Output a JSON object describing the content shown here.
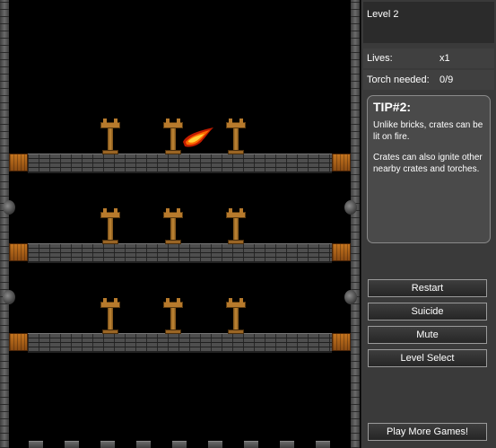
{
  "hud": {
    "level": "Level 2",
    "lives_label": "Lives:",
    "lives_value": "x1",
    "torch_label": "Torch needed:",
    "torch_value": "0/9"
  },
  "tip": {
    "title": "TIP#2:",
    "paragraphs": [
      "Unlike bricks, crates can be lit on fire.",
      "Crates can also ignite other nearby crates and torches."
    ]
  },
  "buttons": {
    "restart": "Restart",
    "suicide": "Suicide",
    "mute": "Mute",
    "level_select": "Level Select",
    "play_more": "Play More Games!"
  },
  "colors": {
    "panel_bg": "#3a3a3a",
    "crate": "#c4741e",
    "torch": "#b77a2c",
    "fire": "#ff9a1a"
  },
  "game": {
    "platforms": 3,
    "torches_per_platform": 3,
    "torches_lit": 0,
    "fireball_present": true
  }
}
